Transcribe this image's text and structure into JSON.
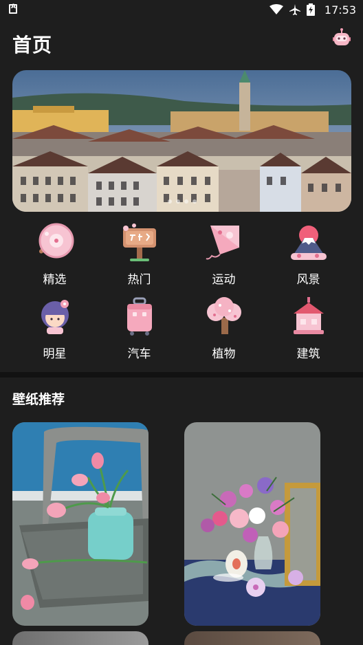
{
  "status_bar": {
    "time": "17:53",
    "icons": [
      "app-a-icon",
      "wifi-icon",
      "airplane-mode-icon",
      "battery-charging-icon"
    ]
  },
  "header": {
    "title": "首页",
    "action_icon": "robot-icon"
  },
  "banner": {
    "image": "city-old-town-church-photo",
    "indicator_count": 4,
    "active_index": 0
  },
  "categories": [
    {
      "label": "精选",
      "icon": "cherry-blossom-fan-icon"
    },
    {
      "label": "热门",
      "icon": "park-signboard-icon"
    },
    {
      "label": "运动",
      "icon": "kite-icon"
    },
    {
      "label": "风景",
      "icon": "mount-fuji-icon"
    },
    {
      "label": "明星",
      "icon": "girl-with-flower-icon"
    },
    {
      "label": "汽车",
      "icon": "suitcase-icon"
    },
    {
      "label": "植物",
      "icon": "blossom-tree-icon"
    },
    {
      "label": "建筑",
      "icon": "house-lantern-icon"
    }
  ],
  "recommend": {
    "title": "壁纸推荐",
    "items": [
      {
        "image": "pink-tulips-on-chair-photo"
      },
      {
        "image": "flower-bouquet-still-life-photo"
      },
      {
        "image": "wallpaper-photo-3"
      },
      {
        "image": "wallpaper-photo-4"
      }
    ]
  },
  "colors": {
    "background": "#1e1e1e",
    "divider": "#121212",
    "accent_pink": "#f4b3c2"
  }
}
